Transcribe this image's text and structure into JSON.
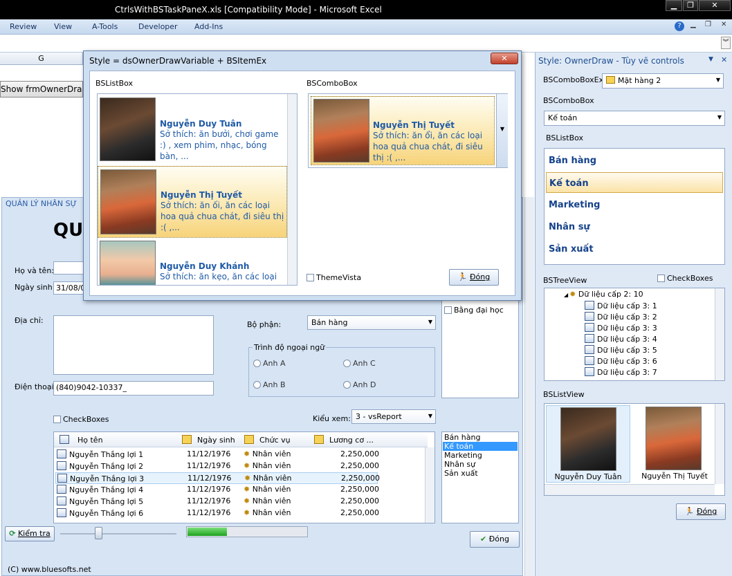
{
  "window": {
    "title": "CtrlsWithBSTaskPaneX.xls  [Compatibility Mode] - Microsoft Excel",
    "minimize": "▁",
    "restore": "❐",
    "close": "✕"
  },
  "ribbon": {
    "tabs": [
      "Review",
      "View",
      "A-Tools",
      "Developer",
      "Add-Ins"
    ],
    "help": "?"
  },
  "sheet": {
    "col_header": "G",
    "show_button": "Show frmOwnerDraw",
    "footer": "(C) www.bluesofts.net"
  },
  "form": {
    "title": "QUẢN LÝ NHÂN SỰ",
    "heading": "QU",
    "name_label": "Họ và tên:",
    "name_value": "",
    "dob_label": "Ngày sinh:",
    "dob_value": "31/08/09",
    "address_label": "Địa chỉ:",
    "address_value": "",
    "phone_label": "Điện thoại:",
    "phone_value": "(840)9042-10337_",
    "dept_label": "Bộ phận:",
    "dept_value": "Bán hàng",
    "lang_group": "Trình độ ngoại ngữ",
    "lang_options": [
      "Anh A",
      "Anh B",
      "Anh C",
      "Anh D"
    ],
    "checklist_items": [
      "Bằng đại học"
    ],
    "checkboxes_label": "CheckBoxes",
    "view_label": "Kiểu xem:",
    "view_value": "3 - vsReport",
    "columns": [
      "Họ tên",
      "Ngày sinh",
      "Chức vụ",
      "Lương cơ ..."
    ],
    "rows": [
      {
        "name": "Nguyễn Thắng lợi 1",
        "dob": "11/12/1976",
        "role": "Nhân viên",
        "salary": "2,250,000"
      },
      {
        "name": "Nguyễn Thắng lợi 2",
        "dob": "11/12/1976",
        "role": "Nhân viên",
        "salary": "2,250,000"
      },
      {
        "name": "Nguyễn Thắng lợi 3",
        "dob": "11/12/1976",
        "role": "Nhân viên",
        "salary": "2,250,000"
      },
      {
        "name": "Nguyễn Thắng lợi 4",
        "dob": "11/12/1976",
        "role": "Nhân viên",
        "salary": "2,250,000"
      },
      {
        "name": "Nguyễn Thắng lợi 5",
        "dob": "11/12/1976",
        "role": "Nhân viên",
        "salary": "2,250,000"
      },
      {
        "name": "Nguyễn Thắng lợi 6",
        "dob": "11/12/1976",
        "role": "Nhân viên",
        "salary": "2,250,000"
      }
    ],
    "dept_list": [
      "Bán hàng",
      "Kế toán",
      "Marketing",
      "Nhân sự",
      "Sản xuất"
    ],
    "dept_list_selected": "Kế toán",
    "check_button": "Kiểm tra",
    "close_button": "Đóng",
    "progress": 0.33
  },
  "dialog": {
    "title": "Style = dsOwnerDrawVariable + BSItemEx",
    "close": "✕",
    "listbox_label": "BSListBox",
    "combobox_label": "BSComboBox",
    "people": [
      {
        "name": "Nguyễn Duy Tuân",
        "desc": "Sở thích: ăn bưởi, chơi game :) , xem phim, nhạc, bóng bàn, ..."
      },
      {
        "name": "Nguyễn Thị Tuyết",
        "desc": "Sở thích: ăn ối, ăn các loại hoa quả chua chát, đi siêu thị :( ,..."
      },
      {
        "name": "Nguyễn Duy Khánh",
        "desc": "Sở thích: ăn kẹo, ăn các loại"
      }
    ],
    "combo_person": {
      "name": "Nguyễn Thị Tuyết",
      "desc": "Sở thích: ăn ổi, ăn các loại hoa quả chua chát, đi siêu thị :( ,..."
    },
    "theme_label": "ThemeVista",
    "close_button": "Đóng"
  },
  "pane": {
    "title": "Style: OwnerDraw - Tùy vẽ controls",
    "comboex_label": "BSComboBoxEx",
    "comboex_value": "Mặt hàng 2",
    "combo_label": "BSComboBox",
    "combo_value": "Kế toán",
    "listbox_label": "BSListBox",
    "list_items": [
      "Bán hàng",
      "Kế toán",
      "Marketing",
      "Nhân sự",
      "Sản xuất"
    ],
    "tree_label": "BSTreeView",
    "tree_checkbox": "CheckBoxes",
    "tree_items": [
      "Dữ liệu cấp 2: 10",
      "Dữ liệu cấp 3: 1",
      "Dữ liệu cấp 3: 2",
      "Dữ liệu cấp 3: 3",
      "Dữ liệu cấp 3: 4",
      "Dữ liệu cấp 3: 5",
      "Dữ liệu cấp 3: 6",
      "Dữ liệu cấp 3: 7"
    ],
    "listview_label": "BSListView",
    "listview_items": [
      "Nguyễn Duy Tuân",
      "Nguyễn Thị Tuyết"
    ],
    "close_button": "Đóng"
  }
}
